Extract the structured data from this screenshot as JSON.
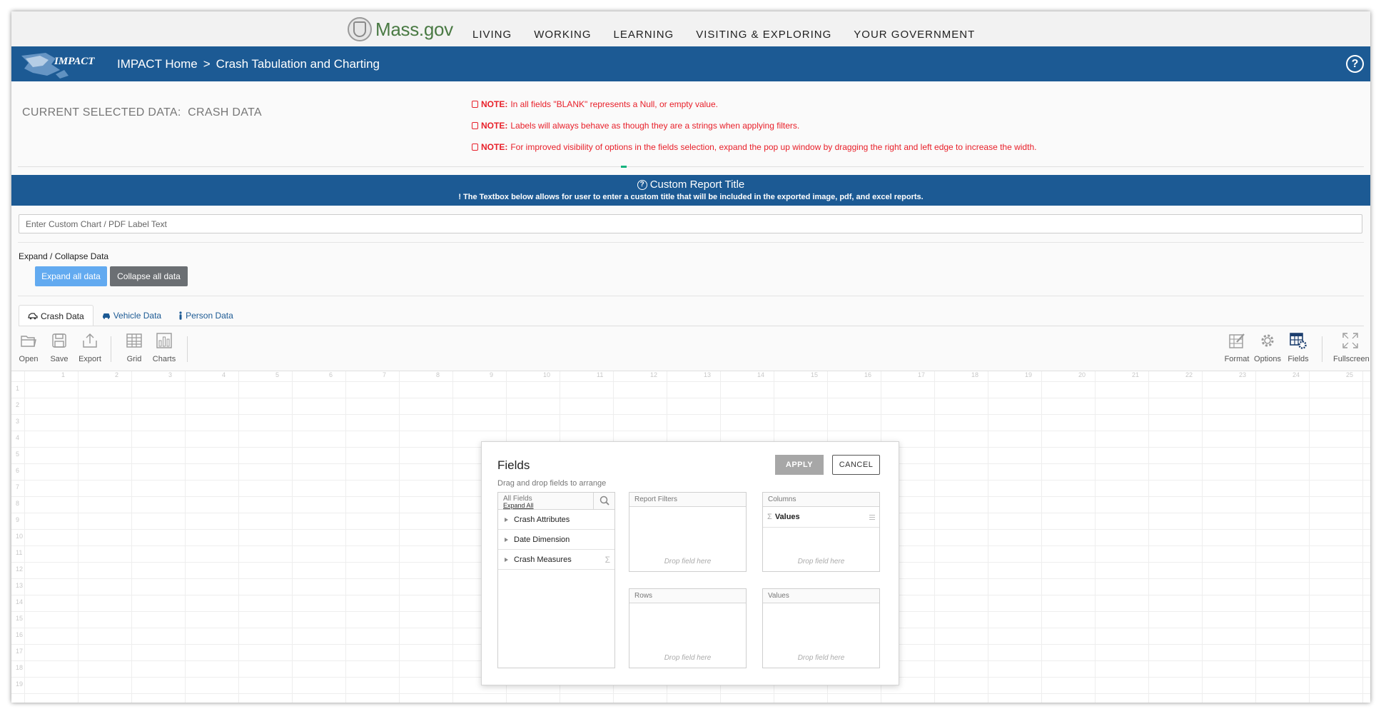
{
  "header": {
    "brand": "Mass.gov",
    "nav": [
      "LIVING",
      "WORKING",
      "LEARNING",
      "VISITING & EXPLORING",
      "YOUR GOVERNMENT"
    ]
  },
  "app": {
    "logo_text": "IMPACT",
    "breadcrumb_home": "IMPACT Home",
    "breadcrumb_sep": ">",
    "breadcrumb_current": "Crash Tabulation and Charting",
    "help_symbol": "?"
  },
  "selection": {
    "label": "CURRENT SELECTED DATA:",
    "value": "CRASH DATA"
  },
  "notes": [
    {
      "prefix": "NOTE:",
      "text": "In all fields \"BLANK\" represents a Null, or empty value."
    },
    {
      "prefix": "NOTE:",
      "text": "Labels will always behave as though they are a strings when applying filters."
    },
    {
      "prefix": "NOTE:",
      "text": "For improved visibility of options in the fields selection, expand the pop up window by dragging the right and left edge to increase the width."
    }
  ],
  "custom_title": {
    "heading": "Custom Report Title",
    "info": "The Textbox below allows for user to enter a custom title that will be included in the exported image, pdf, and excel reports.",
    "placeholder": "Enter Custom Chart / PDF Label Text"
  },
  "expand": {
    "label": "Expand / Collapse Data",
    "expand_btn": "Expand all data",
    "collapse_btn": "Collapse all data"
  },
  "tabs": [
    {
      "label": "Crash Data",
      "active": true
    },
    {
      "label": "Vehicle Data",
      "active": false
    },
    {
      "label": "Person Data",
      "active": false
    }
  ],
  "toolbar": {
    "open": "Open",
    "save": "Save",
    "export": "Export",
    "grid": "Grid",
    "charts": "Charts",
    "format": "Format",
    "options": "Options",
    "fields": "Fields",
    "fullscreen": "Fullscreen"
  },
  "grid": {
    "columns": [
      "1",
      "2",
      "3",
      "4",
      "5",
      "6",
      "7",
      "8",
      "9",
      "10",
      "11",
      "12",
      "13",
      "14",
      "15",
      "16",
      "17",
      "18",
      "19",
      "20",
      "21",
      "22",
      "23",
      "24",
      "25"
    ],
    "rows": [
      "1",
      "2",
      "3",
      "4",
      "5",
      "6",
      "7",
      "8",
      "9",
      "10",
      "11",
      "12",
      "13",
      "14",
      "15",
      "16",
      "17",
      "18",
      "19"
    ]
  },
  "fields_dialog": {
    "title": "Fields",
    "subtitle": "Drag and drop fields to arrange",
    "apply": "APPLY",
    "cancel": "CANCEL",
    "all_fields": {
      "title": "All Fields",
      "expand_all": "Expand All",
      "items": [
        "Crash Attributes",
        "Date Dimension",
        "Crash Measures"
      ]
    },
    "report_filters": {
      "title": "Report Filters",
      "drop": "Drop field here"
    },
    "columns": {
      "title": "Columns",
      "item": "Values",
      "drop": "Drop field here"
    },
    "rows": {
      "title": "Rows",
      "drop": "Drop field here"
    },
    "values": {
      "title": "Values",
      "drop": "Drop field here"
    },
    "sigma": "Σ"
  },
  "colors": {
    "brand_blue": "#1c5a94",
    "note_red": "#e8202a",
    "expand_blue": "#62aaf0",
    "collapse_gray": "#6b6f73",
    "mass_green": "#4a7a44"
  }
}
